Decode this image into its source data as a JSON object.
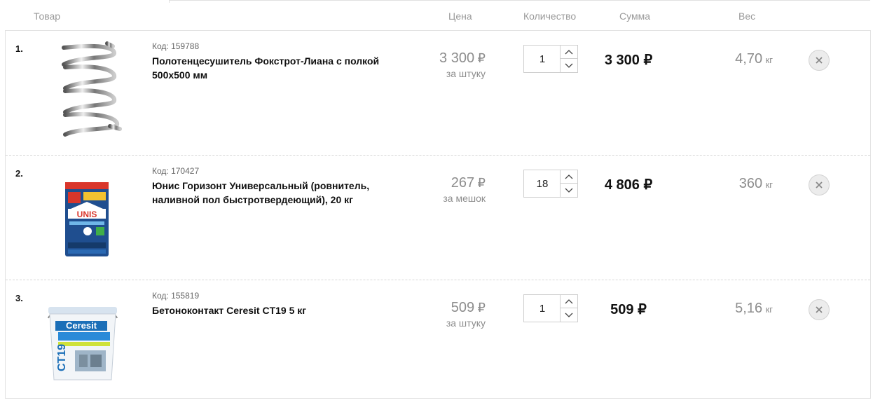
{
  "header": {
    "product": "Товар",
    "price": "Цена",
    "quantity": "Количество",
    "sum": "Сумма",
    "weight": "Вес"
  },
  "currency": "₽",
  "items": [
    {
      "num": "1.",
      "code": "Код: 159788",
      "title": "Полотенцесушитель Фокстрот-Лиана с полкой 500х500 мм",
      "price": "3 300",
      "unit": "за штуку",
      "qty": "1",
      "sum": "3 300",
      "weight": "4,70",
      "weight_unit": "кг",
      "image_icon": "towel-dryer"
    },
    {
      "num": "2.",
      "code": "Код: 170427",
      "title": "Юнис Горизонт Универсальный (ровнитель, наливной пол быстротвердеющий), 20 кг",
      "price": "267",
      "unit": "за мешок",
      "qty": "18",
      "sum": "4 806",
      "weight": "360",
      "weight_unit": "кг",
      "image_icon": "cement-bag",
      "image_text": "UNIS"
    },
    {
      "num": "3.",
      "code": "Код: 155819",
      "title": "Бетоноконтакт Ceresit CT19 5 кг",
      "price": "509",
      "unit": "за штуку",
      "qty": "1",
      "sum": "509",
      "weight": "5,16",
      "weight_unit": "кг",
      "image_icon": "paint-bucket",
      "image_text": "Ceresit",
      "image_text2": "CT19"
    }
  ]
}
